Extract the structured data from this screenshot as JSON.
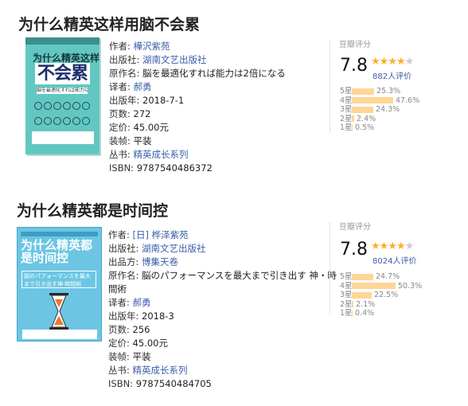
{
  "books": [
    {
      "title": "为什么精英这样用脑不会累",
      "cover": {
        "title": "为什么精英这样用脑",
        "big": "不会累",
        "sub": "脳を最適化すれば能力は2倍になる",
        "color": "#62c7c2"
      },
      "info": {
        "author_label": "作者:",
        "author": "樺沢紫苑",
        "publisher_label": "出版社:",
        "publisher": "湖南文艺出版社",
        "original_label": "原作名:",
        "original": "脳を最適化すれば能力は2倍になる",
        "translator_label": "译者:",
        "translator": "郝勇",
        "date_label": "出版年:",
        "date": "2018-7-1",
        "pages_label": "页数:",
        "pages": "272",
        "price_label": "定价:",
        "price": "45.00元",
        "binding_label": "装帧:",
        "binding": "平装",
        "series_label": "丛书:",
        "series": "精英成长系列",
        "isbn_label": "ISBN:",
        "isbn": "9787540486372"
      },
      "rating": {
        "head": "豆瓣评分",
        "score": "7.8",
        "stars": 4,
        "people": "882人评价",
        "dist": [
          {
            "label": "5星",
            "value": 25.3,
            "pct": "25.3%"
          },
          {
            "label": "4星",
            "value": 47.6,
            "pct": "47.6%"
          },
          {
            "label": "3星",
            "value": 24.3,
            "pct": "24.3%"
          },
          {
            "label": "2星",
            "value": 2.4,
            "pct": "2.4%"
          },
          {
            "label": "1星",
            "value": 0.5,
            "pct": "0.5%"
          }
        ]
      }
    },
    {
      "title": "为什么精英都是时间控",
      "cover": {
        "title": "为什么精英都是时间控",
        "sub": "脳のパフォーマンスを最大まで引き出す神·時間術",
        "color": "#6cc6e3"
      },
      "info": {
        "author_label": "作者:",
        "author": "[日] 桦泽紫苑",
        "publisher_label": "出版社:",
        "publisher": "湖南文艺出版社",
        "producer_label": "出品方:",
        "producer": "博集天卷",
        "original_label": "原作名:",
        "original_1": "脳のパフォーマンスを最大まで引き出す 神・時",
        "original_2": "間術",
        "translator_label": "译者:",
        "translator": "郝勇",
        "date_label": "出版年:",
        "date": "2018-3",
        "pages_label": "页数:",
        "pages": "256",
        "price_label": "定价:",
        "price": "45.00元",
        "binding_label": "装帧:",
        "binding": "平装",
        "series_label": "丛书:",
        "series": "精英成长系列",
        "isbn_label": "ISBN:",
        "isbn": "9787540484705"
      },
      "rating": {
        "head": "豆瓣评分",
        "score": "7.8",
        "stars": 4,
        "people": "8024人评价",
        "dist": [
          {
            "label": "5星",
            "value": 24.7,
            "pct": "24.7%"
          },
          {
            "label": "4星",
            "value": 50.3,
            "pct": "50.3%"
          },
          {
            "label": "3星",
            "value": 22.5,
            "pct": "22.5%"
          },
          {
            "label": "2星",
            "value": 2.1,
            "pct": "2.1%"
          },
          {
            "label": "1星",
            "value": 0.4,
            "pct": "0.4%"
          }
        ]
      }
    }
  ]
}
